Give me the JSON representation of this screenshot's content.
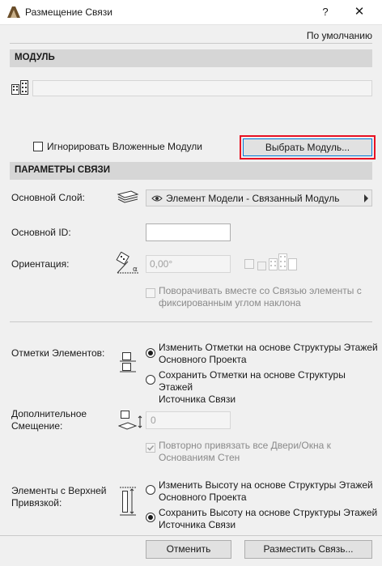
{
  "window": {
    "title": "Размещение Связи",
    "help_label": "?",
    "close_label": "✕"
  },
  "toolbar": {
    "default_label": "По умолчанию"
  },
  "module_section": {
    "header": "МОДУЛЬ",
    "module_path_value": "",
    "ignore_nested_label": "Игнорировать Вложенные Модули",
    "ignore_nested_checked": false,
    "choose_module_label": "Выбрать Модуль..."
  },
  "link_params_section": {
    "header": "ПАРАМЕТРЫ СВЯЗИ",
    "main_layer_label": "Основной Слой:",
    "main_layer_value": "Элемент Модели - Связанный Модуль",
    "main_id_label": "Основной ID:",
    "main_id_value": "",
    "orientation_label": "Ориентация:",
    "orientation_value": "0,00°",
    "rotate_with_link_label_line1": "Поворачивать вместе со Связью элементы с",
    "rotate_with_link_label_line2": "фиксированным углом наклона",
    "element_elevations_label": "Отметки Элементов:",
    "elev_option1_line1": "Изменить Отметки на основе Структуры Этажей",
    "elev_option1_line2": "Основного Проекта",
    "elev_option2_line1": "Сохранить Отметки на основе Структуры Этажей",
    "elev_option2_line2": "Источника Связи",
    "elev_selected": 1,
    "extra_offset_label_line1": "Дополнительное",
    "extra_offset_label_line2": "Смещение:",
    "extra_offset_value": "0",
    "rebind_doors_label_line1": "Повторно привязать все Двери/Окна к",
    "rebind_doors_label_line2": "Основаниям Стен",
    "rebind_doors_checked": true,
    "top_linked_label_line1": "Элементы с Верхней",
    "top_linked_label_line2": "Привязкой:",
    "top_option1_line1": "Изменить Высоту на основе Структуры Этажей",
    "top_option1_line2": "Основного Проекта",
    "top_option2_line1": "Сохранить Высоту на основе Структуры Этажей",
    "top_option2_line2": "Источника Связи",
    "top_selected": 2
  },
  "footer": {
    "cancel_label": "Отменить",
    "place_label": "Разместить Связь..."
  },
  "colors": {
    "highlight_border": "#e81123",
    "focus_blue": "#0078d7",
    "section_bg": "#d6d6d6"
  }
}
